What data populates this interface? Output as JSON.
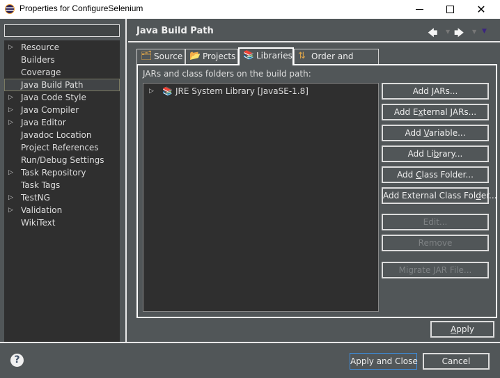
{
  "window": {
    "title": "Properties for ConfigureSelenium",
    "minimize_icon": "minimize-icon",
    "maximize_icon": "maximize-icon",
    "close_icon": "close-icon"
  },
  "sidebar": {
    "filter": {
      "value": "",
      "placeholder": ""
    },
    "items": [
      {
        "label": "Resource",
        "expandable": true,
        "selected": false
      },
      {
        "label": "Builders",
        "expandable": false,
        "selected": false
      },
      {
        "label": "Coverage",
        "expandable": false,
        "selected": false
      },
      {
        "label": "Java Build Path",
        "expandable": false,
        "selected": true
      },
      {
        "label": "Java Code Style",
        "expandable": true,
        "selected": false
      },
      {
        "label": "Java Compiler",
        "expandable": true,
        "selected": false
      },
      {
        "label": "Java Editor",
        "expandable": true,
        "selected": false
      },
      {
        "label": "Javadoc Location",
        "expandable": false,
        "selected": false
      },
      {
        "label": "Project References",
        "expandable": false,
        "selected": false
      },
      {
        "label": "Run/Debug Settings",
        "expandable": false,
        "selected": false
      },
      {
        "label": "Task Repository",
        "expandable": true,
        "selected": false
      },
      {
        "label": "Task Tags",
        "expandable": false,
        "selected": false
      },
      {
        "label": "TestNG",
        "expandable": true,
        "selected": false
      },
      {
        "label": "Validation",
        "expandable": true,
        "selected": false
      },
      {
        "label": "WikiText",
        "expandable": false,
        "selected": false
      }
    ]
  },
  "page": {
    "title": "Java Build Path",
    "nav": {
      "back": "back-arrow-icon",
      "forward": "forward-arrow-icon",
      "menu": "view-menu-icon"
    },
    "tabs": [
      {
        "label": "Source",
        "icon": "source-folder-icon",
        "active": false
      },
      {
        "label": "Projects",
        "icon": "project-folder-icon",
        "active": false
      },
      {
        "label": "Libraries",
        "icon": "library-icon",
        "active": true
      },
      {
        "label": "Order and Export",
        "icon": "order-export-icon",
        "active": false
      }
    ],
    "libraries": {
      "description": "JARs and class folders on the build path:",
      "entries": [
        {
          "label": "JRE System Library [JavaSE-1.8]",
          "icon": "library-icon",
          "expandable": true
        }
      ],
      "buttons": [
        {
          "pre": "Add ",
          "mnemonic": "J",
          "post": "ARs...",
          "enabled": true
        },
        {
          "pre": "Add E",
          "mnemonic": "x",
          "post": "ternal JARs...",
          "enabled": true
        },
        {
          "pre": "Add ",
          "mnemonic": "V",
          "post": "ariable...",
          "enabled": true
        },
        {
          "pre": "Add Li",
          "mnemonic": "b",
          "post": "rary...",
          "enabled": true
        },
        {
          "pre": "Add ",
          "mnemonic": "C",
          "post": "lass Folder...",
          "enabled": true
        },
        {
          "pre": "Add External Class Fol",
          "mnemonic": "d",
          "post": "er...",
          "enabled": true
        },
        {
          "pre": "Edit...",
          "mnemonic": "",
          "post": "",
          "enabled": false
        },
        {
          "pre": "Remove",
          "mnemonic": "",
          "post": "",
          "enabled": false
        },
        {
          "pre": "Migrate JAR File...",
          "mnemonic": "",
          "post": "",
          "enabled": false
        }
      ]
    },
    "apply": {
      "mnemonic": "A",
      "post": "pply"
    }
  },
  "footer": {
    "help_icon": "help-icon",
    "apply_and_close": "Apply and Close",
    "cancel": "Cancel"
  }
}
